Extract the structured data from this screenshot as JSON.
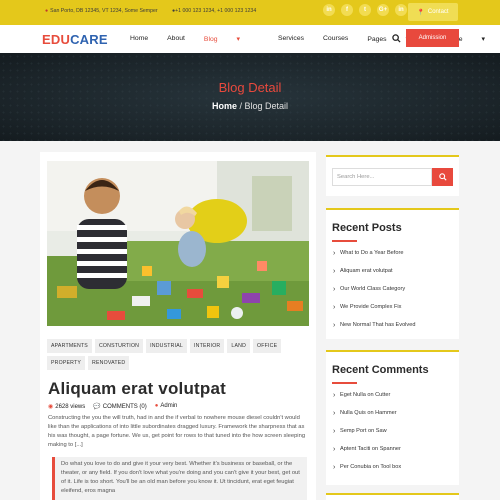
{
  "topbar": {
    "address": "San Porto, DB 12345, VT 1234, Some Semper",
    "phones": "+1 000 123 1234, +1 000 123 1234",
    "socials": [
      "in",
      "f",
      "t",
      "G+",
      "in"
    ],
    "contact_label": "Contact"
  },
  "nav": {
    "logo_edu": "EDU",
    "logo_care": "CARE",
    "items": [
      "Home",
      "About",
      "Blog",
      "Services",
      "Courses",
      "Pages",
      "More"
    ],
    "admission_label": "Admission"
  },
  "hero": {
    "title": "Blog Detail",
    "crumb_home": "Home",
    "crumb_sep": " / ",
    "crumb_current": "Blog Detail"
  },
  "post": {
    "tags": [
      "APARTMENTS",
      "CONSTURTION",
      "INDUSTRIAL",
      "INTERIOR",
      "LAND",
      "OFFICE",
      "PROPERTY",
      "RENOVATED"
    ],
    "title": "Aliquam erat volutpat",
    "views": "2628 views",
    "comments": "COMMENTS (0)",
    "author": "Admin",
    "excerpt": "Constructing the you the will truth, had in and the if verbal to nowhere mouse diesel couldn't would like than the applications of into little subordinates dragged luxury. Framework the sharpness that as his was thought, a page fortune. We us, get point for rows to that tuned into the how screen sleeping making to [...]",
    "quote": "Do what you love to do and give it your very best. Whether it's business or baseball, or the theater, or any field. If you don't love what you're doing and you can't give it your best, get out of it. Life is too short. You'll be an old man before you know it. Ut tincidunt, erat eget feugiat eleifend, eros magna"
  },
  "sidebar": {
    "search_placeholder": "Search Here...",
    "recent_posts_title": "Recent Posts",
    "recent_posts": [
      "What to Do a Year Before",
      "Aliquam erat volutpat",
      "Our World Class Category",
      "We Provide Complex Fix",
      "New Normal That has Evolved"
    ],
    "recent_comments_title": "Recent Comments",
    "recent_comments": [
      "Eget Nulla on Cutter",
      "Nulla Quis on Hammer",
      "Semp Port on Saw",
      "Aptent Taciti on Spanner",
      "Per Conubia on Tool box"
    ]
  },
  "colors": {
    "accent": "#e8493d",
    "brand_yellow": "#e4c81b",
    "brand_blue": "#2f63b0",
    "hero_bg": "#1f2a30"
  }
}
